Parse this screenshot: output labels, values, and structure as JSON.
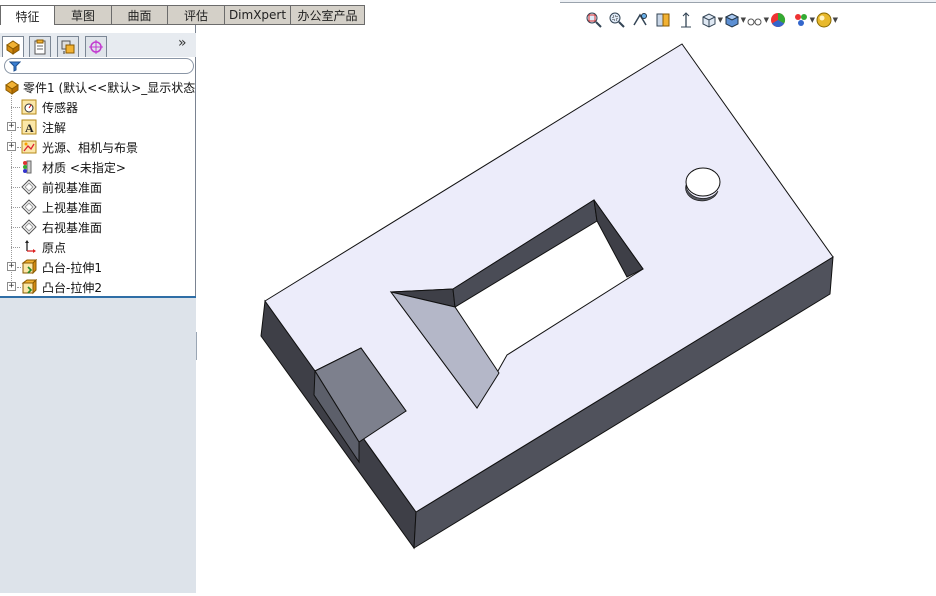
{
  "tabs": [
    {
      "label": "特征",
      "active": true
    },
    {
      "label": "草图",
      "active": false
    },
    {
      "label": "曲面",
      "active": false
    },
    {
      "label": "评估",
      "active": false
    },
    {
      "label": "DimXpert",
      "active": false
    },
    {
      "label": "办公室产品",
      "active": false
    }
  ],
  "manager_tabs": [
    "feature-manager-icon",
    "property-manager-icon",
    "configuration-manager-icon",
    "dim-xpert-manager-icon"
  ],
  "manager_chevron": "»",
  "tree": {
    "root_label": "零件1  (默认<<默认>_显示状态",
    "items": [
      {
        "label": "传感器",
        "icon": "sensor-icon",
        "expandable": false
      },
      {
        "label": "注解",
        "icon": "annotation-icon",
        "expandable": true
      },
      {
        "label": "光源、相机与布景",
        "icon": "lights-cameras-icon",
        "expandable": true
      },
      {
        "label": "材质 <未指定>",
        "icon": "material-icon",
        "expandable": false
      },
      {
        "label": "前视基准面",
        "icon": "plane-icon",
        "expandable": false
      },
      {
        "label": "上视基准面",
        "icon": "plane-icon",
        "expandable": false
      },
      {
        "label": "右视基准面",
        "icon": "plane-icon",
        "expandable": false
      },
      {
        "label": "原点",
        "icon": "origin-icon",
        "expandable": false
      },
      {
        "label": "凸台-拉伸1",
        "icon": "boss-extrude-icon",
        "expandable": true
      },
      {
        "label": "凸台-拉伸2",
        "icon": "boss-extrude-icon",
        "expandable": true
      }
    ]
  },
  "view_tools": [
    {
      "name": "zoom-to-fit-icon",
      "dropdown": false
    },
    {
      "name": "zoom-to-area-icon",
      "dropdown": false
    },
    {
      "name": "previous-view-icon",
      "dropdown": false
    },
    {
      "name": "section-view-icon",
      "dropdown": false
    },
    {
      "name": "dynamic-annotation-icon",
      "dropdown": false
    },
    {
      "name": "view-orientation-icon",
      "dropdown": true
    },
    {
      "name": "display-style-icon",
      "dropdown": true
    },
    {
      "name": "hide-show-items-icon",
      "dropdown": true
    },
    {
      "name": "edit-appearance-icon",
      "dropdown": false
    },
    {
      "name": "apply-scene-icon",
      "dropdown": true
    },
    {
      "name": "view-settings-icon",
      "dropdown": true
    }
  ],
  "colors": {
    "part_top_face": "#ececfa",
    "part_side_dark": "#3e3f47",
    "part_side_mid": "#50525c",
    "pocket_wall_light": "#b4b7c8",
    "slot_wall": "#7d808d",
    "selection_line": "#2f6ea6",
    "panel_lower": "#dde3ea"
  }
}
